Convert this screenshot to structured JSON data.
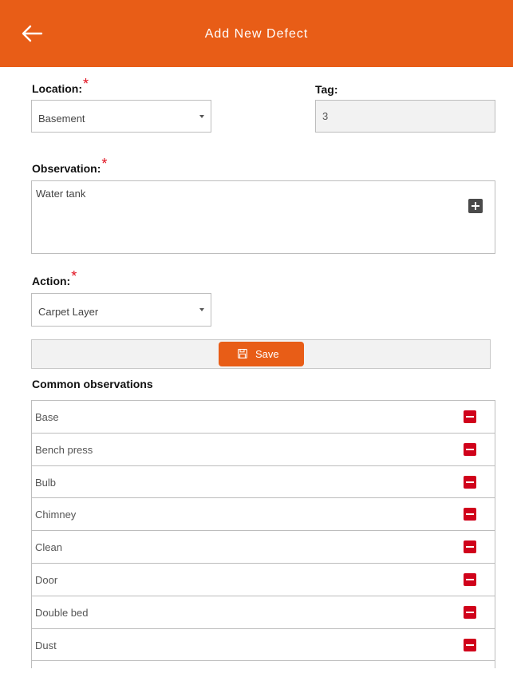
{
  "header": {
    "title": "Add New Defect",
    "back_icon": "arrow-left-icon"
  },
  "colors": {
    "accent": "#e85d17",
    "required": "#e0101e",
    "remove": "#d0021b"
  },
  "form": {
    "location_label": "Location:",
    "location_value": "Basement",
    "tag_label": "Tag:",
    "tag_value": "3",
    "observation_label": "Observation:",
    "observation_value": "Water tank",
    "action_label": "Action:",
    "action_value": "Carpet Layer",
    "required_mark": "*",
    "save_label": "Save"
  },
  "common_observations": {
    "title": "Common observations",
    "items": [
      "Base",
      "Bench press",
      "Bulb",
      "Chimney",
      "Clean",
      "Door",
      "Double bed",
      "Dust"
    ]
  }
}
